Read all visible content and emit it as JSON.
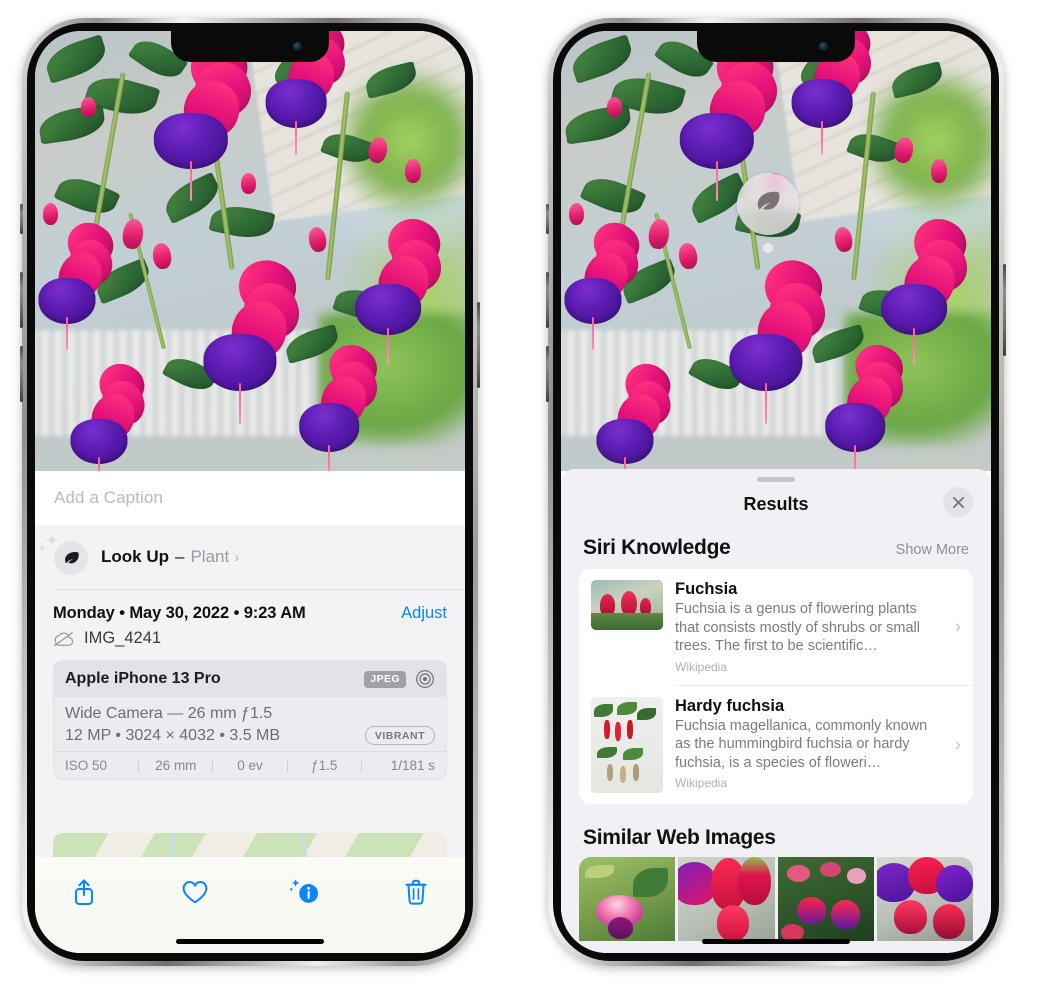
{
  "app": {
    "name": "Photos",
    "screens": [
      "photo-info",
      "visual-lookup-results"
    ]
  },
  "colors": {
    "accent_blue": "#0A84FF",
    "sheet_bg": "#F1F1F5",
    "card_bg": "#FFFFFF",
    "secondary_text": "#8E8E93",
    "primary_text": "#111111"
  },
  "left_phone": {
    "caption": {
      "placeholder": "Add a Caption",
      "value": ""
    },
    "lookup": {
      "icon": "leaf-icon",
      "title": "Look Up",
      "separator": "–",
      "subject": "Plant",
      "chevron": "›"
    },
    "meta": {
      "date_line": "Monday • May 30, 2022 • 9:23 AM",
      "adjust_label": "Adjust",
      "cloud_icon": "icloud-slash-icon",
      "filename": "IMG_4241"
    },
    "exif": {
      "device": "Apple iPhone 13 Pro",
      "format_badge": "JPEG",
      "aperture_icon": "aperture-icon",
      "lens": "Wide Camera — 26 mm ƒ1.5",
      "size_line": "12 MP • 3024 × 4032 • 3.5 MB",
      "style_badge": "VIBRANT",
      "stats": [
        "ISO 50",
        "26 mm",
        "0 ev",
        "ƒ1.5",
        "1/181 s"
      ]
    },
    "map": {
      "pin_label": "photo-location-pin"
    },
    "toolbar": [
      {
        "name": "share-button",
        "icon": "share-icon"
      },
      {
        "name": "favorite-button",
        "icon": "heart-icon"
      },
      {
        "name": "info-button",
        "icon": "info-sparkle-icon"
      },
      {
        "name": "delete-button",
        "icon": "trash-icon"
      }
    ]
  },
  "right_phone": {
    "badge": {
      "icon": "leaf-icon",
      "name": "visual-lookup-badge"
    },
    "sheet": {
      "title": "Results",
      "close_icon": "close-icon",
      "sections": [
        {
          "title": "Siri Knowledge",
          "action_label": "Show More",
          "items": [
            {
              "title": "Fuchsia",
              "description": "Fuchsia is a genus of flowering plants that consists mostly of shrubs or small trees. The first to be scientific…",
              "source": "Wikipedia",
              "chevron": "›"
            },
            {
              "title": "Hardy fuchsia",
              "description": "Fuchsia magellanica, commonly known as the hummingbird fuchsia or hardy fuchsia, is a species of floweri…",
              "source": "Wikipedia",
              "chevron": "›"
            }
          ]
        },
        {
          "title": "Similar Web Images",
          "images": [
            "web-image-1",
            "web-image-2",
            "web-image-3",
            "web-image-4"
          ]
        }
      ]
    }
  }
}
